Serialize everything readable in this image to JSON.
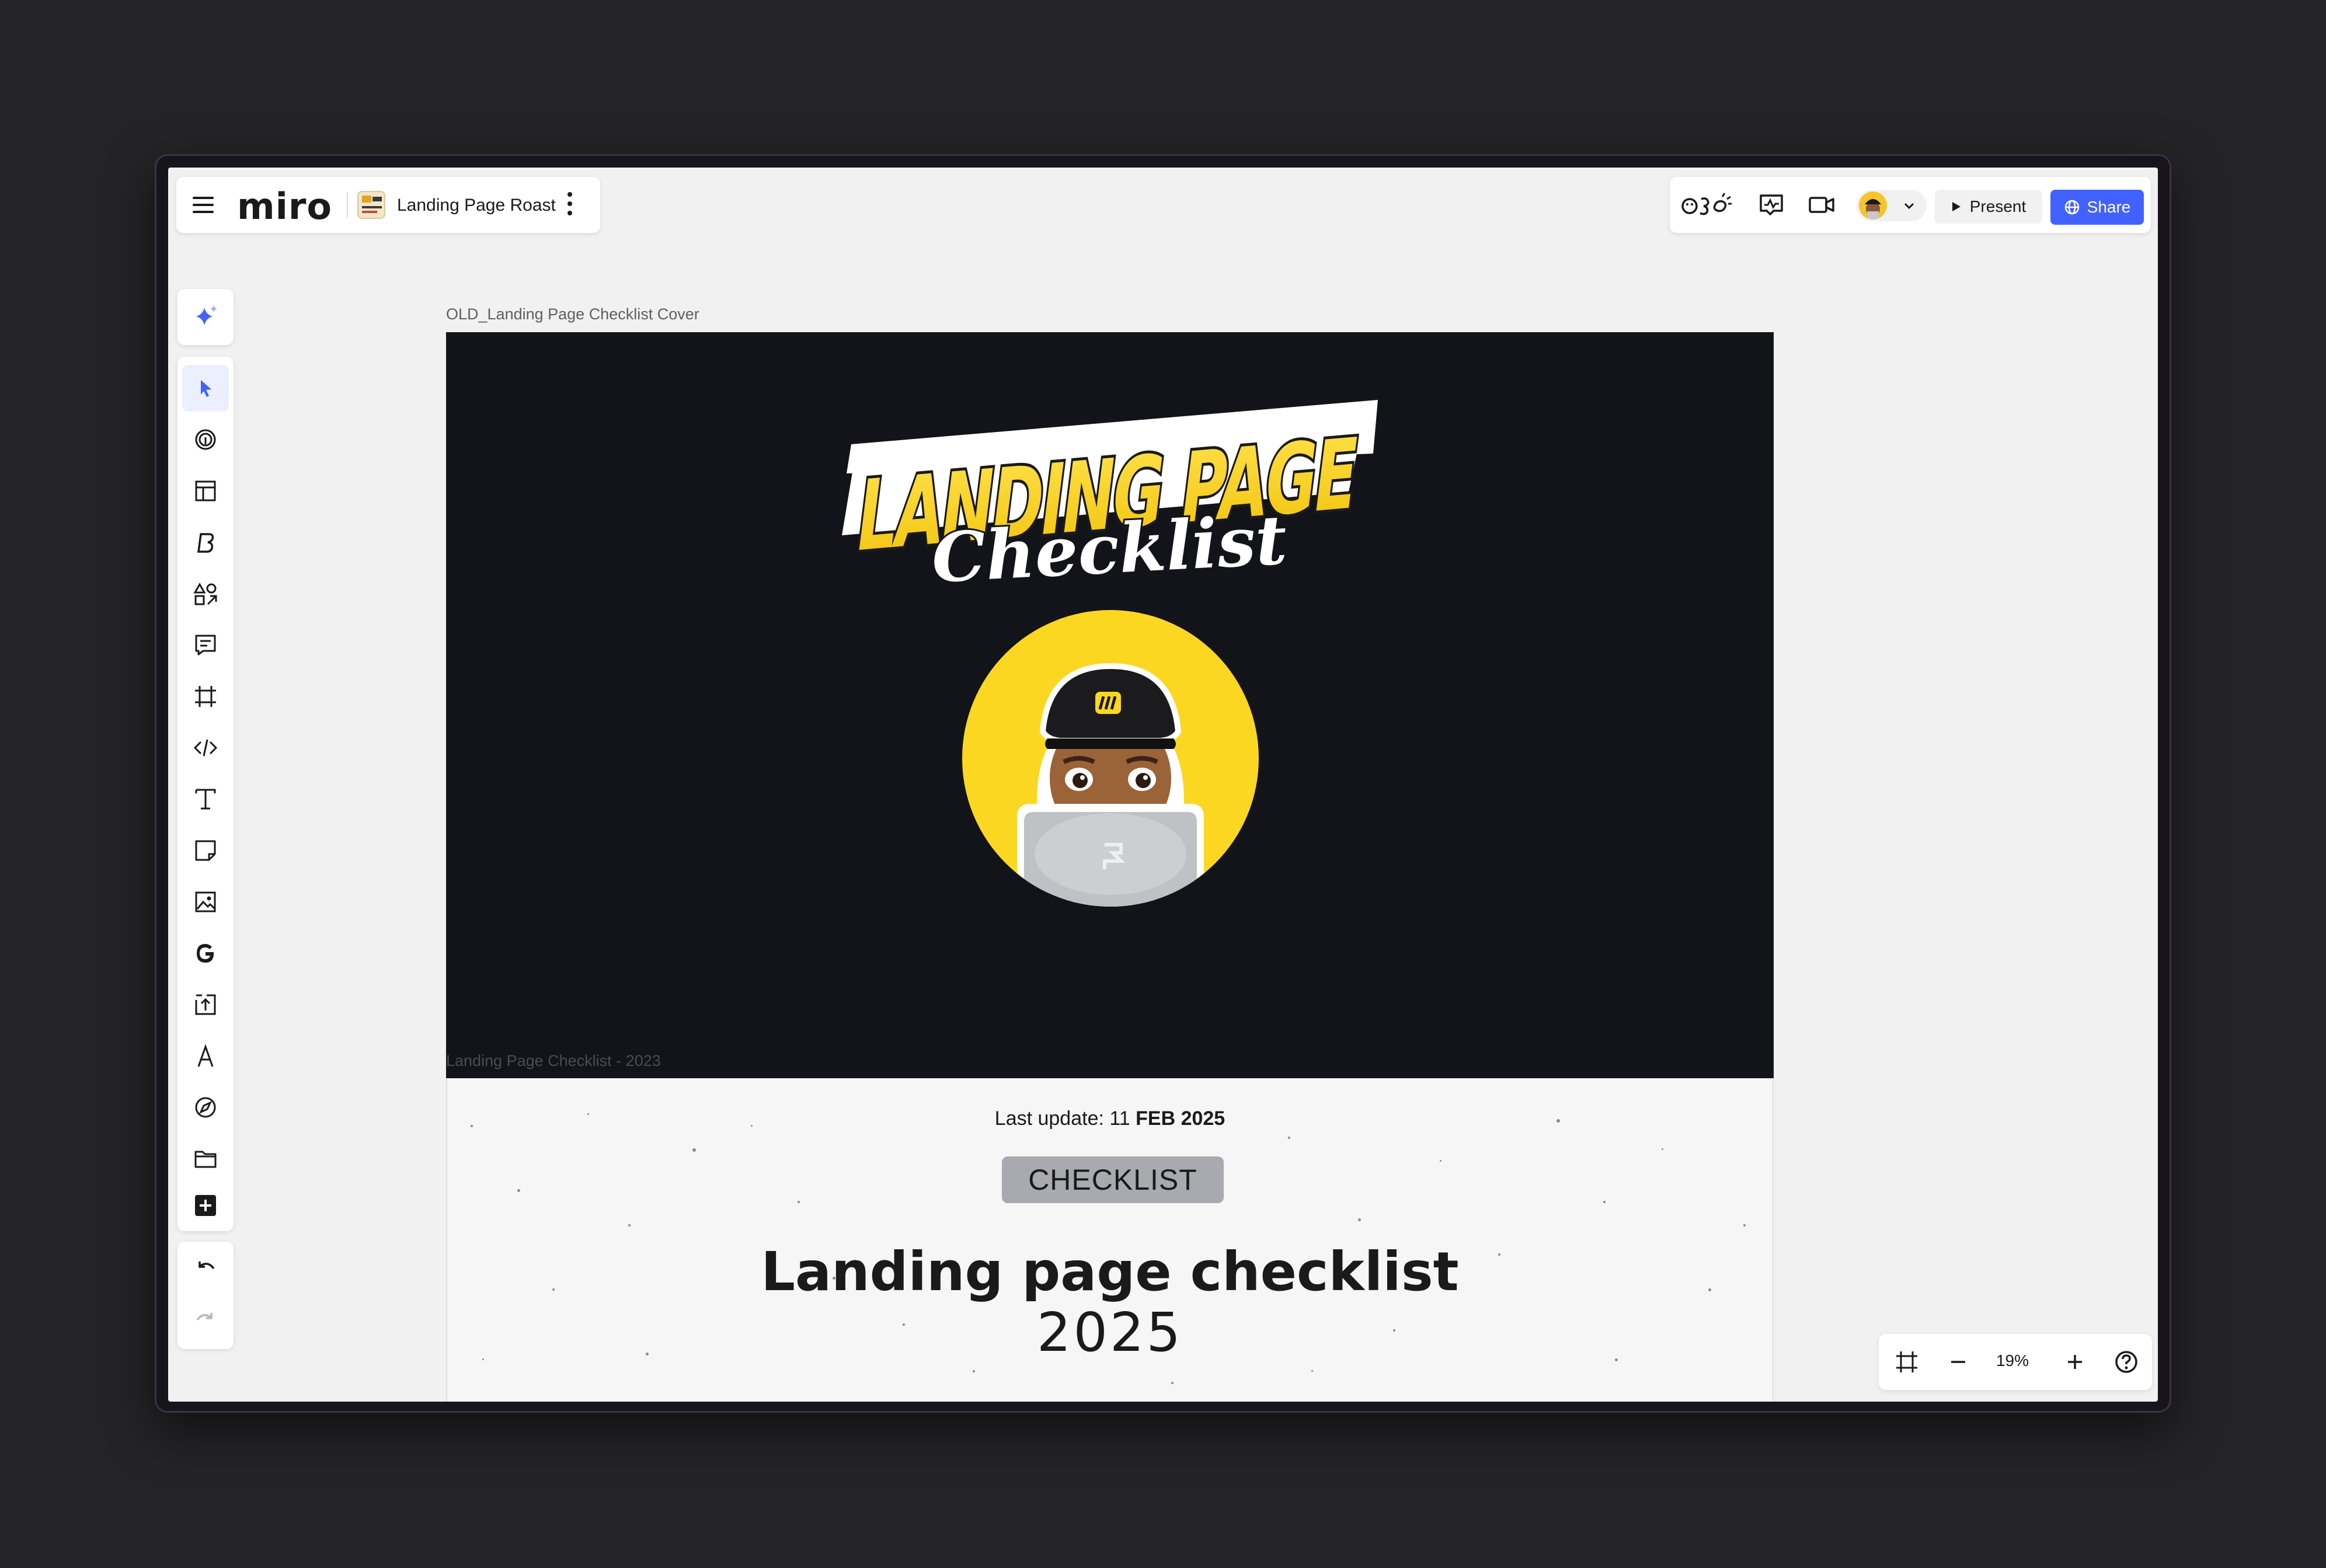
{
  "board": {
    "logo": "miro",
    "name": "Landing Page Roast"
  },
  "collab": {
    "present_label": "Present",
    "share_label": "Share",
    "icons": [
      "reactions-icon",
      "activity-icon",
      "video-call-icon",
      "user-avatar",
      "chevron-down-icon"
    ]
  },
  "toolbar": {
    "tools": [
      "ai-sparkle-icon",
      "select-cursor-icon",
      "fingerprint-icon",
      "templates-icon",
      "brand-icon",
      "shapes-icon",
      "comment-icon",
      "frame-icon",
      "embed-code-icon",
      "text-icon",
      "sticky-note-icon",
      "image-icon",
      "google-icon",
      "upload-icon",
      "pen-icon",
      "explore-icon",
      "folder-icon",
      "more-apps-icon"
    ],
    "undo": "undo-icon",
    "redo": "redo-icon"
  },
  "frame": {
    "label": "OLD_Landing Page Checklist Cover",
    "logo_line1": "LANDING PAGE",
    "logo_line2": "Checklist",
    "footer": "Landing Page Checklist - 2023"
  },
  "document": {
    "last_update_prefix": "Last update: 11 ",
    "last_update_bold": "FEB 2025",
    "badge": "CHECKLIST",
    "title": "Landing page checklist",
    "year": "2025"
  },
  "zoom": {
    "value": "19%"
  },
  "colors": {
    "accent": "#4262ff",
    "brand_yellow": "#f5d21a",
    "frame_dark": "#131419",
    "canvas": "#f1f1f1"
  }
}
